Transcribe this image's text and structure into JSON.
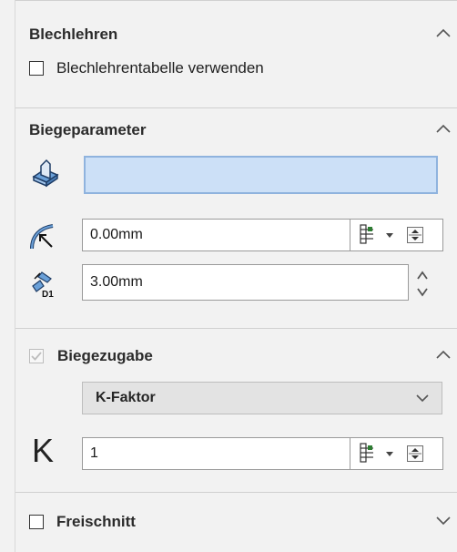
{
  "sections": {
    "gauges": {
      "title": "Blechlehren",
      "use_table_label": "Blechlehrentabelle verwenden",
      "use_table_checked": false
    },
    "bend_params": {
      "title": "Biegeparameter",
      "face_value": "",
      "radius_value": "0.00mm",
      "thickness_value": "3.00mm",
      "icons": [
        "fixed-face-icon",
        "bend-radius-icon",
        "thickness-icon"
      ]
    },
    "bend_allowance": {
      "title": "Biegezugabe",
      "checked": true,
      "enabled": false,
      "type_option": "K-Faktor",
      "k_symbol": "K",
      "k_value": "1"
    },
    "relief": {
      "title": "Freischnitt",
      "checked": false
    }
  },
  "colors": {
    "selection_field": "#cce0f7",
    "selection_border": "#8fb3de",
    "panel_bg": "#f2f2f2",
    "combo_bg": "#e3e3e3"
  }
}
